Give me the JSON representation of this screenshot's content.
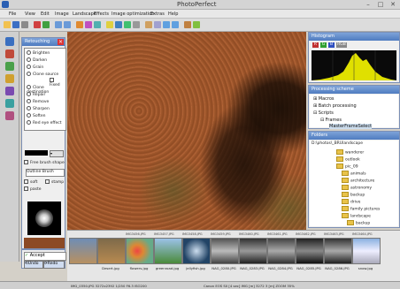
{
  "app": {
    "title": "PhotoPerfect"
  },
  "menu": [
    "File",
    "View",
    "Edit",
    "Image",
    "Landscape",
    "Effects",
    "Image optimization",
    "Extras",
    "Help"
  ],
  "panels": {
    "retouching": {
      "title": "Retouching",
      "tools": [
        "Brighten",
        "Darken",
        "Grain",
        "Clone source",
        "Fixed",
        "Clone destination",
        "Repair",
        "Remove",
        "Sharpen",
        "Soften",
        "Red eye effect"
      ],
      "brush_shape_label": "Free brush shape",
      "brush_select": "Outline Brush",
      "options": [
        "soft",
        "stamp",
        "paste"
      ],
      "accept_label": "Accept",
      "undo_label": "Undo",
      "redo_label": "Redo"
    },
    "histogram": {
      "title": "Histogram",
      "buttons": [
        "R",
        "G",
        "B",
        "RGB"
      ]
    },
    "processing": {
      "title": "Processing scheme",
      "items": [
        "Macros",
        "Batch processing",
        "Scripts",
        "Frames",
        "MasterFrameSelect"
      ]
    },
    "folders": {
      "title": "Folders",
      "path": "D:\\photos\\_BRUlandscape",
      "items": [
        "wanderer",
        "outlook",
        "pic_09",
        "animals",
        "architecture",
        "astronomy",
        "backup",
        "drive",
        "family pictures",
        "landscape",
        "backup"
      ]
    }
  },
  "thumbnails": [
    {
      "tag": "",
      "name": ""
    },
    {
      "tag": "",
      "name": "Desert.jpg"
    },
    {
      "tag": "IMG3456.JPG",
      "name": "flowers.jpg"
    },
    {
      "tag": "IMG3457.JPG",
      "name": "greenroad.jpg"
    },
    {
      "tag": "IMG3458.JPG",
      "name": "jellyfish.jpg"
    },
    {
      "tag": "IMG3459.JPG",
      "name": "NAG_0280.JPG"
    },
    {
      "tag": "IMG3460.JPG",
      "name": "NAG_0283.JPG"
    },
    {
      "tag": "IMG3461.JPG",
      "name": "NAG_0284.JPG"
    },
    {
      "tag": "IMG3462.JPG",
      "name": "NAG_0285.JPG"
    },
    {
      "tag": "IMG3463.JPG",
      "name": "NAG_0286.JPG"
    },
    {
      "tag": "IMG3464.JPG",
      "name": "snow.jpg"
    }
  ],
  "status": {
    "left": "IMG_0350.JPG  3272x2392  1/250  F6.3  ISO200",
    "right": "Canon EOS  S0 [4 sec]  IMG [m]  3272 3 [m]  ZOOM 35%"
  },
  "colors": {
    "accent": "#4f7cc0",
    "canvas": "#a05a30",
    "histo": "#d4d400"
  }
}
